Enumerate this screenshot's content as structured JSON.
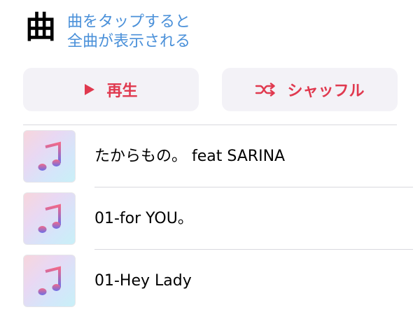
{
  "header": {
    "title": "曲",
    "hint_line1": "曲をタップすると",
    "hint_line2": "全曲が表示される"
  },
  "buttons": {
    "play_label": "再生",
    "shuffle_label": "シャッフル",
    "play_icon": "play-icon",
    "shuffle_icon": "shuffle-icon"
  },
  "songs": [
    {
      "title": "たからもの。 feat  SARINA",
      "artwork_icon": "music-note-icon"
    },
    {
      "title": "01-for YOU。",
      "artwork_icon": "music-note-icon"
    },
    {
      "title": "01-Hey Lady",
      "artwork_icon": "music-note-icon"
    }
  ],
  "colors": {
    "accent": "#e0394f",
    "link": "#4a90d9",
    "button_bg": "#f3f2f7"
  }
}
